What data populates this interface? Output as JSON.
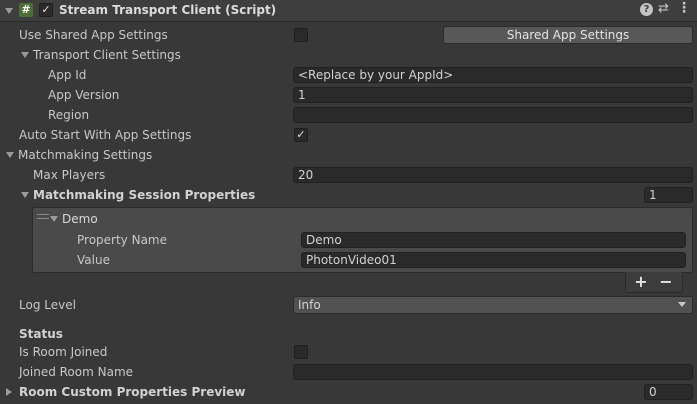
{
  "header": {
    "title": "Stream Transport Client (Script)",
    "enabled": true,
    "script_icon": "#"
  },
  "use_shared_app_settings": {
    "label": "Use Shared App Settings",
    "checked": false,
    "button_label": "Shared App Settings"
  },
  "transport_client_settings": {
    "label": "Transport Client Settings",
    "app_id": {
      "label": "App Id",
      "value": "<Replace by your AppId>"
    },
    "app_version": {
      "label": "App Version",
      "value": "1"
    },
    "region": {
      "label": "Region",
      "value": ""
    }
  },
  "auto_start": {
    "label": "Auto Start With App Settings",
    "checked": true
  },
  "matchmaking_settings": {
    "label": "Matchmaking Settings",
    "max_players": {
      "label": "Max Players",
      "value": "20"
    },
    "session_properties": {
      "label": "Matchmaking Session Properties",
      "count": "1",
      "items": [
        {
          "label": "Demo",
          "property_name": {
            "label": "Property Name",
            "value": "Demo"
          },
          "value": {
            "label": "Value",
            "value": "PhotonVideo01"
          }
        }
      ]
    },
    "add_label": "+",
    "remove_label": "−"
  },
  "log_level": {
    "label": "Log Level",
    "value": "Info"
  },
  "status": {
    "label": "Status",
    "is_room_joined": {
      "label": "Is Room Joined",
      "checked": false
    },
    "joined_room_name": {
      "label": "Joined Room Name",
      "value": ""
    },
    "room_custom_properties_preview": {
      "label": "Room Custom Properties Preview",
      "count": "0"
    }
  }
}
